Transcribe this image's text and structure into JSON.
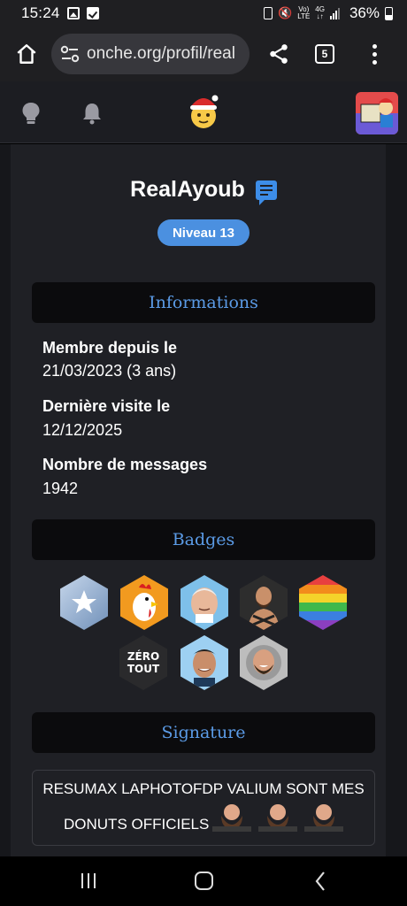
{
  "status_bar": {
    "time": "15:24",
    "network_top": "Vo)",
    "network_bottom": "LTE",
    "gen": "4G",
    "battery": "36%"
  },
  "browser": {
    "url": "onche.org/profil/real",
    "tab_count": "5"
  },
  "profile": {
    "username": "RealAyoub",
    "level": "Niveau 13"
  },
  "sections": {
    "informations": "Informations",
    "badges": "Badges",
    "signature": "Signature"
  },
  "info": [
    {
      "label": "Membre depuis le",
      "value": "21/03/2023 (3 ans)"
    },
    {
      "label": "Dernière visite le",
      "value": "12/12/2025"
    },
    {
      "label": "Nombre de messages",
      "value": "1942"
    }
  ],
  "badges": [
    {
      "name": "star-badge",
      "color": "#9fb7d6"
    },
    {
      "name": "rooster-badge",
      "color": "#f28c1c"
    },
    {
      "name": "hide-the-pain-harold-badge",
      "color": "#6fb3e0"
    },
    {
      "name": "bearded-man-badge",
      "color": "#3b3b3b"
    },
    {
      "name": "rainbow-badge",
      "color": "#e84a5f"
    },
    {
      "name": "zero-tout-badge",
      "color": "#2a2a2a",
      "text": "ZÉRO TOUT"
    },
    {
      "name": "smiling-man-badge",
      "color": "#8cc8f0"
    },
    {
      "name": "laughing-man-badge",
      "color": "#b5b5b5"
    }
  ],
  "signature": {
    "line1": "RESUMAX LAPHOTOFDP VALIUM SONT MES",
    "line2": "DONUTS OFFICIELS"
  }
}
